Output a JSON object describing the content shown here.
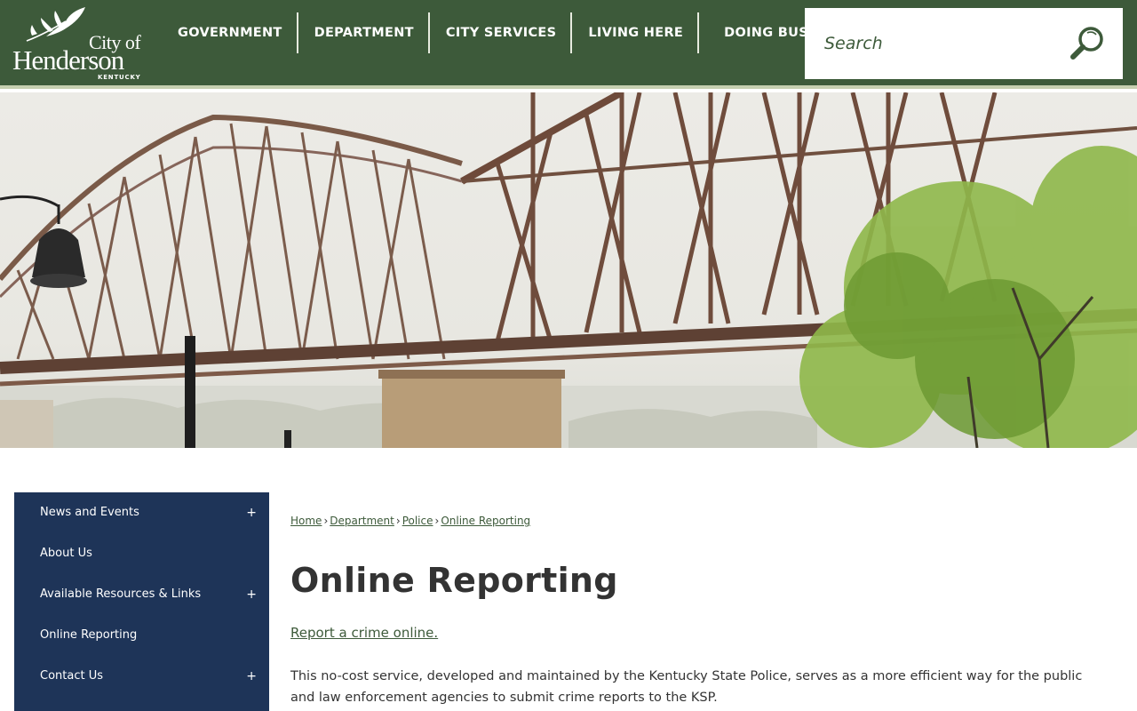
{
  "header": {
    "logo": {
      "line1": "City of",
      "line2": "Henderson",
      "line3": "KENTUCKY"
    },
    "nav": [
      {
        "label": "GOVERNMENT"
      },
      {
        "label": "DEPARTMENT"
      },
      {
        "label": "CITY SERVICES"
      },
      {
        "label": "LIVING HERE"
      },
      {
        "label": "DOING BUSINESS"
      }
    ],
    "search": {
      "placeholder": "Search",
      "icon": "magnifier-icon"
    }
  },
  "hero": {
    "image": "bridge-photo"
  },
  "sidebar": {
    "items": [
      {
        "label": "News and Events",
        "expand": "+"
      },
      {
        "label": "About Us"
      },
      {
        "label": "Available Resources & Links",
        "expand": "+"
      },
      {
        "label": "Online Reporting"
      },
      {
        "label": "Contact Us",
        "expand": "+"
      }
    ]
  },
  "breadcrumb": {
    "items": [
      "Home",
      "Department",
      "Police",
      "Online Reporting"
    ],
    "separator": "›"
  },
  "main": {
    "title": "Online Reporting",
    "link_text": "Report a crime online.",
    "paragraph": "This no-cost service, developed and maintained by the Kentucky State Police, serves as a more efficient way for the public and law enforcement agencies to submit crime reports to the KSP."
  },
  "colors": {
    "header_bg": "#3d5a3a",
    "sidebar_bg": "#1e3458",
    "link": "#3d5a3a"
  }
}
